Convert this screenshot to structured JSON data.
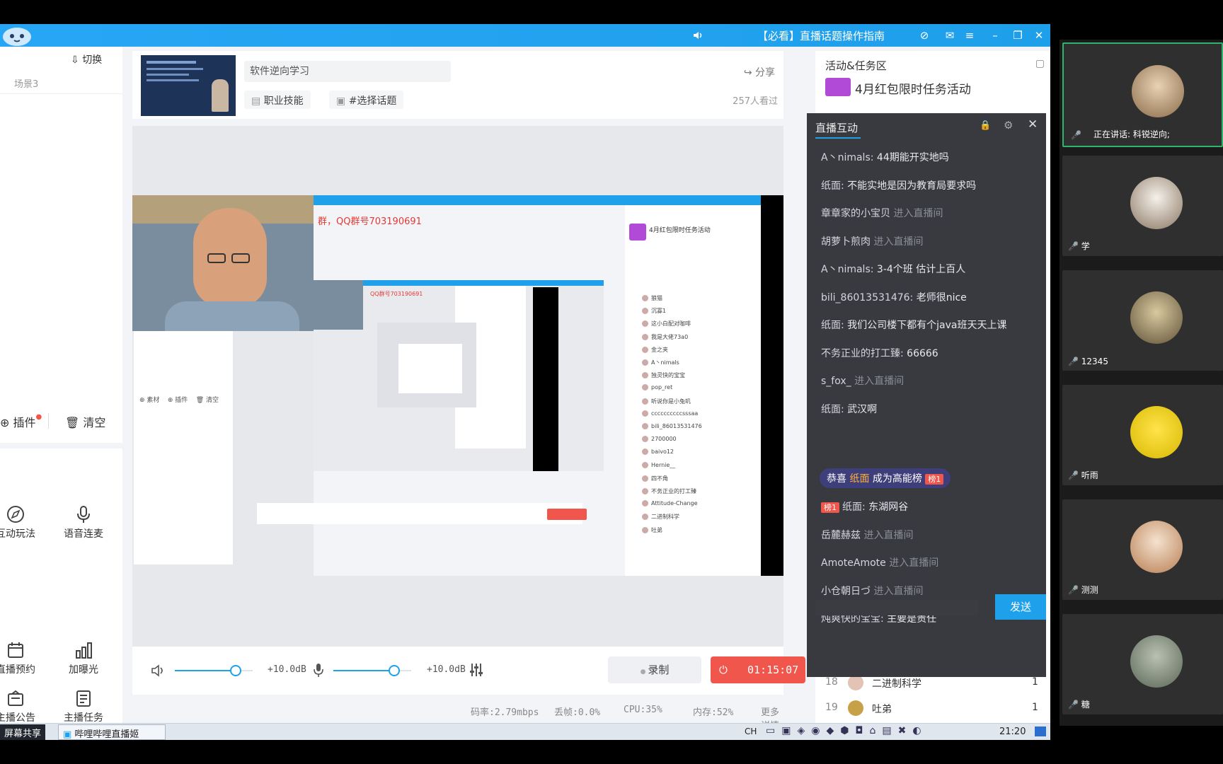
{
  "window": {
    "title": "【必看】直播话题操作指南",
    "colors": {
      "accent": "#1ea0eb",
      "live_red": "#f0564b",
      "chat_bg": "#2d2e34"
    }
  },
  "left_panel": {
    "switch_label": "切换",
    "scene_label": "场景3",
    "plugin_label": "插件",
    "clear_label": "清空",
    "grid": [
      {
        "label": "互动玩法",
        "icon": "compass-icon"
      },
      {
        "label": "语音连麦",
        "icon": "mic-wave-icon"
      },
      {
        "label": "直播预约",
        "icon": "calendar-icon"
      },
      {
        "label": "加曝光",
        "icon": "bar-chart-icon"
      },
      {
        "label": "主播公告",
        "icon": "notice-icon"
      },
      {
        "label": "主播任务",
        "icon": "task-icon"
      }
    ]
  },
  "room": {
    "title": "软件逆向学习",
    "share_label": "分享",
    "category": "职业技能",
    "topic": "#选择话题",
    "viewers": "257人看过"
  },
  "preview": {
    "qq_text": "群，QQ群号703190691",
    "qq_text_small": "QQ群号703190691",
    "inner_rank_names": [
      "狼猫",
      "沉寡1",
      "这小白配对咖啡",
      "我是大佬73a0",
      "金之夹",
      "A丶nimals",
      "独灵快的宝宝",
      "pop_ret",
      "听说你是小兔叽",
      "ccccccccccsssaa",
      "bili_86013531476",
      "2700000",
      "baivo12",
      "Hernie__",
      "四不角",
      "不务正业的打工臻",
      "Attitude-Change",
      "二进制科学",
      "吐弟"
    ]
  },
  "controls": {
    "vol1": "+10.0dB",
    "vol2": "+10.0dB",
    "vol1_level": 0.78,
    "vol2_level": 0.78,
    "record_label": "录制",
    "timer": "01:15:07"
  },
  "status": {
    "bitrate": "码率:2.79mbps",
    "drop": "丢帧:0.0%",
    "cpu": "CPU:35%",
    "mem": "内存:52%",
    "more": "更多详情"
  },
  "activity": {
    "header": "活动&任务区",
    "banner": "4月红包限时任务活动",
    "rank_rows": [
      {
        "num": "18",
        "name": "二进制科学",
        "score": "1"
      },
      {
        "num": "19",
        "name": "吐弟",
        "score": "1"
      }
    ]
  },
  "chat": {
    "title": "直播互动",
    "messages": [
      {
        "name": "A丶nimals:",
        "text": "44期能开实地吗",
        "type": "msg"
      },
      {
        "name": "纸面:",
        "text": "不能实地是因为教育局要求吗",
        "type": "msg"
      },
      {
        "name": "章章家的小宝贝",
        "text": "进入直播间",
        "type": "enter"
      },
      {
        "name": "胡萝卜煎肉",
        "text": "进入直播间",
        "type": "enter"
      },
      {
        "name": "A丶nimals:",
        "text": "3-4个班 估计上百人",
        "type": "msg"
      },
      {
        "name": "bili_86013531476:",
        "text": "老师很nice",
        "type": "msg"
      },
      {
        "name": "纸面:",
        "text": "我们公司楼下都有个java班天天上课",
        "type": "msg"
      },
      {
        "name": "不务正业的打工臻:",
        "text": "66666",
        "type": "msg"
      },
      {
        "name": "s_fox_",
        "text": "进入直播间",
        "type": "enter"
      },
      {
        "name": "纸面:",
        "text": "武汉啊",
        "type": "msg"
      }
    ],
    "highlight": {
      "prefix": "恭喜",
      "name": "纸面",
      "suffix": "成为高能榜",
      "badge": "榜1"
    },
    "messages2": [
      {
        "badge": "榜1",
        "name": "纸面:",
        "text": "东湖网谷",
        "type": "msg"
      },
      {
        "name": "岳麓赫兹",
        "text": "进入直播间",
        "type": "enter"
      },
      {
        "name": "AmoteAmote",
        "text": "进入直播间",
        "type": "enter"
      },
      {
        "name": "小仓朝日づ",
        "text": "进入直播间",
        "type": "enter"
      },
      {
        "name": "炖爽快的宝宝:",
        "text": "主要是责任",
        "type": "msg"
      }
    ],
    "send_label": "发送"
  },
  "taskbar": {
    "screen_share": "屏幕共享",
    "app": "哔哩哔哩直播姬",
    "ime": "CH",
    "clock": "21:20"
  },
  "participants": {
    "speaking": "正在讲话: 科锐逆向;",
    "tiles": [
      {
        "name": "学"
      },
      {
        "name": "12345"
      },
      {
        "name": "听雨"
      },
      {
        "name": "测测"
      },
      {
        "name": "糖"
      }
    ]
  }
}
